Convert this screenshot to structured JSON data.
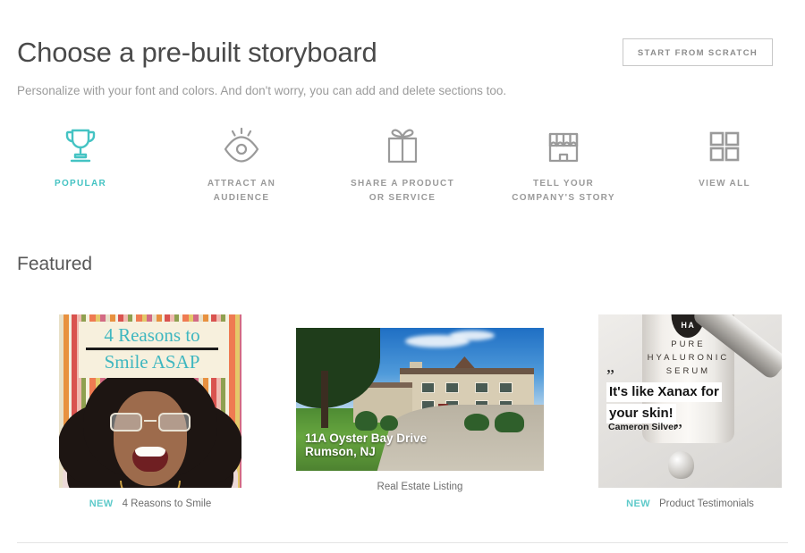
{
  "header": {
    "title": "Choose a pre-built storyboard",
    "subtitle": "Personalize with your font and colors. And don't worry, you can add and delete sections too.",
    "scratch_button": "START FROM SCRATCH"
  },
  "categories": [
    {
      "label": "POPULAR",
      "icon": "trophy-icon",
      "active": true
    },
    {
      "label": "ATTRACT AN AUDIENCE",
      "icon": "eye-icon",
      "active": false
    },
    {
      "label": "SHARE A PRODUCT OR SERVICE",
      "icon": "gift-icon",
      "active": false
    },
    {
      "label": "TELL YOUR COMPANY'S STORY",
      "icon": "storefront-icon",
      "active": false
    },
    {
      "label": "VIEW ALL",
      "icon": "grid-icon",
      "active": false
    }
  ],
  "featured": {
    "heading": "Featured",
    "new_badge": "NEW",
    "cards": [
      {
        "title": "4 Reasons to Smile",
        "is_new": true,
        "thumb_text_line1": "4 Reasons to",
        "thumb_text_line2": "Smile ASAP"
      },
      {
        "title": "Real Estate Listing",
        "is_new": false,
        "thumb_text_line1": "11A Oyster Bay Drive",
        "thumb_text_line2": "Rumson, NJ"
      },
      {
        "title": "Product Testimonials",
        "is_new": true,
        "thumb_brand": "HA",
        "thumb_label_line1": "PURE",
        "thumb_label_line2": "HYALURONIC",
        "thumb_label_line3": "SERUM",
        "quote_line1": "It's like Xanax for",
        "quote_line2": "your skin!",
        "attribution": "Cameron Silver"
      }
    ]
  },
  "colors": {
    "accent_teal": "#44c3c3",
    "text_dark": "#4a4a4a",
    "text_muted": "#9a9a9a",
    "icon_gray": "#9a9a9a",
    "border_gray": "#c8c8c8"
  }
}
